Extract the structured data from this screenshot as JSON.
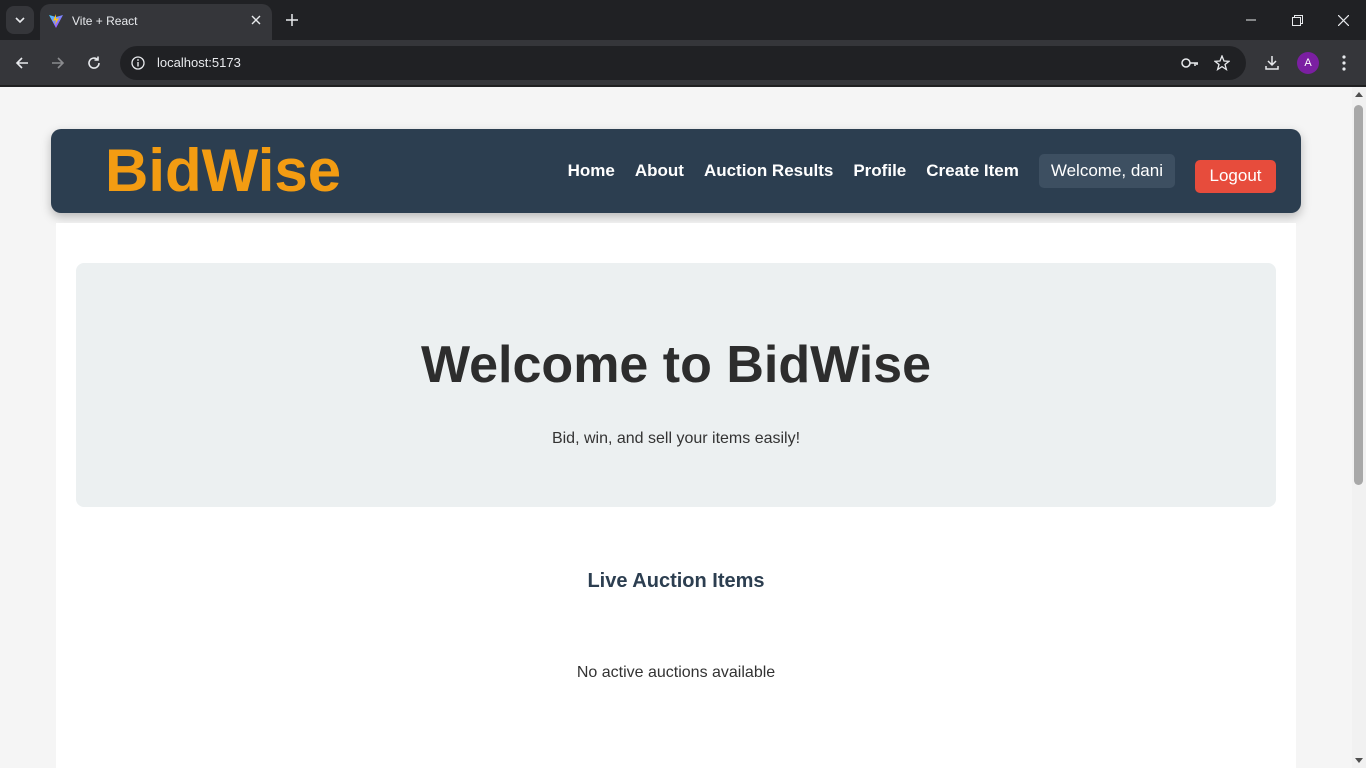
{
  "browser": {
    "tab_title": "Vite + React",
    "url": "localhost:5173",
    "profile_initial": "A"
  },
  "navbar": {
    "brand": "BidWise",
    "links": [
      "Home",
      "About",
      "Auction Results",
      "Profile",
      "Create Item"
    ],
    "welcome": "Welcome, dani",
    "logout_label": "Logout"
  },
  "hero": {
    "title": "Welcome to BidWise",
    "subtitle": "Bid, win, and sell your items easily!"
  },
  "auctions": {
    "section_title": "Live Auction Items",
    "empty_message": "No active auctions available"
  },
  "colors": {
    "navbar_bg": "#2c3e50",
    "brand": "#f39c12",
    "logout": "#e74c3c",
    "hero_bg": "#ecf0f1"
  }
}
